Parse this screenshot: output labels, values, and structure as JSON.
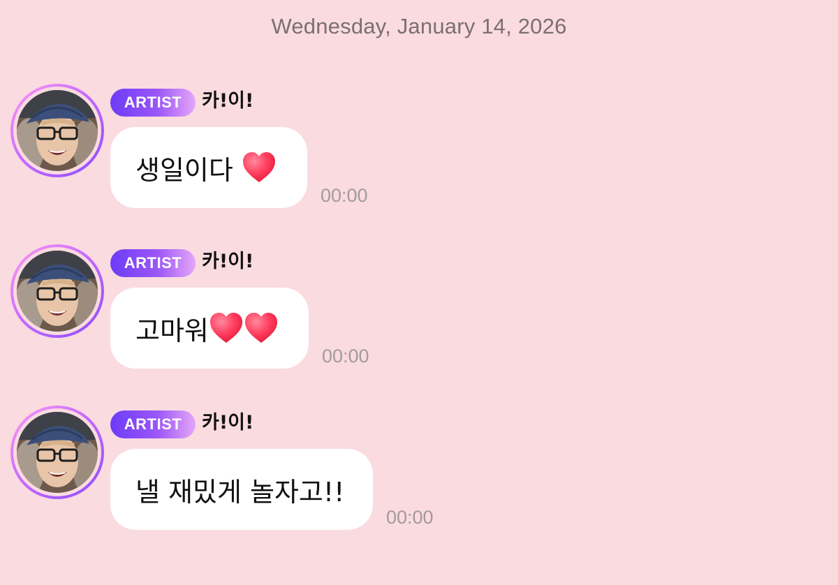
{
  "date_header": "Wednesday, January 14, 2026",
  "messages": [
    {
      "badge": "ARTIST",
      "sender": "카!이!",
      "text": "생일이다",
      "emoji": [
        "red-heart"
      ],
      "time": "00:00"
    },
    {
      "badge": "ARTIST",
      "sender": "카!이!",
      "text": "고마워",
      "emoji": [
        "red-heart",
        "red-heart"
      ],
      "time": "00:00"
    },
    {
      "badge": "ARTIST",
      "sender": "카!이!",
      "text": "낼 재밌게 놀자고!!",
      "emoji": [],
      "time": "00:00"
    }
  ],
  "colors": {
    "background": "#fadbe0",
    "bubble": "#ffffff",
    "badge_start": "#6d3cf8",
    "badge_end": "#e4a6f9",
    "heart": "#ff3d5e",
    "date_text": "#7b6f73",
    "time_text": "#a39a9d"
  }
}
